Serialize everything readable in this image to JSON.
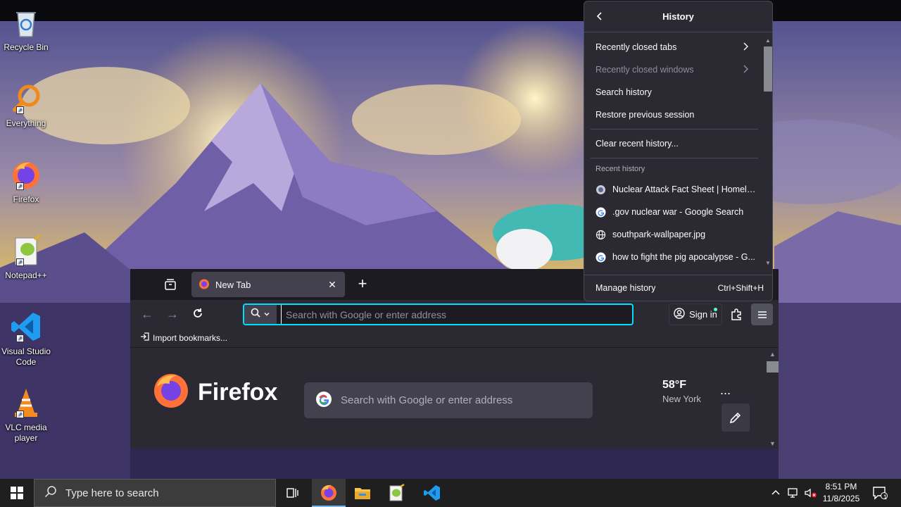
{
  "desktop": {
    "icons": [
      {
        "label": "Recycle Bin"
      },
      {
        "label": "Everything"
      },
      {
        "label": "Firefox"
      },
      {
        "label": "Notepad++"
      },
      {
        "label": "Visual Studio Code"
      },
      {
        "label": "VLC media player"
      }
    ]
  },
  "browser": {
    "tab": {
      "title": "New Tab",
      "close": "✕"
    },
    "new_tab": "+",
    "urlbar": {
      "placeholder": "Search with Google or enter address"
    },
    "sign_in": "Sign in",
    "bookmarks": {
      "import_label": "Import bookmarks..."
    },
    "newtab_page": {
      "brand": "Firefox",
      "search_placeholder": "Search with Google or enter address",
      "weather": {
        "temp": "58°F",
        "city": "New York"
      },
      "more": "..."
    }
  },
  "history_panel": {
    "title": "History",
    "items": [
      {
        "label": "Recently closed tabs",
        "has_submenu": true,
        "enabled": true
      },
      {
        "label": "Recently closed windows",
        "has_submenu": true,
        "enabled": false
      },
      {
        "label": "Search history",
        "enabled": true
      },
      {
        "label": "Restore previous session",
        "enabled": true
      },
      {
        "label": "Clear recent history...",
        "enabled": true
      }
    ],
    "recent_heading": "Recent history",
    "recent": [
      {
        "title": "Nuclear Attack Fact Sheet | Homela...",
        "icon": "site-icon"
      },
      {
        "title": ".gov nuclear war - Google Search",
        "icon": "google-icon"
      },
      {
        "title": "southpark-wallpaper.jpg",
        "icon": "globe-icon"
      },
      {
        "title": "how to fight the pig apocalypse - G...",
        "icon": "google-icon"
      }
    ],
    "footer": {
      "label": "Manage history",
      "shortcut": "Ctrl+Shift+H"
    }
  },
  "taskbar": {
    "search_placeholder": "Type here to search",
    "clock": {
      "time": "8:51 PM",
      "date": "11/8/2025"
    },
    "notification_count": "1"
  }
}
